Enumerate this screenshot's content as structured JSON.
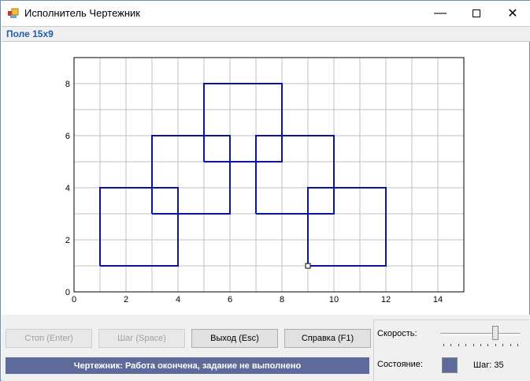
{
  "window": {
    "title": "Исполнитель Чертежник",
    "minimize_icon": "minimize-icon",
    "maximize_icon": "maximize-icon",
    "close_icon": "close-icon"
  },
  "infobar": {
    "label": "Поле 15x9"
  },
  "field": {
    "x_range": [
      0,
      15
    ],
    "y_range": [
      0,
      9
    ],
    "x_ticks": [
      "0",
      "2",
      "4",
      "6",
      "8",
      "10",
      "12",
      "14"
    ],
    "y_ticks": [
      "0",
      "2",
      "4",
      "6",
      "8"
    ],
    "line_color": "#0a14a0",
    "grid_color": "#c0c0c0",
    "segments": [
      [
        [
          1,
          1
        ],
        [
          1,
          4
        ],
        [
          4,
          4
        ],
        [
          4,
          1
        ],
        [
          1,
          1
        ]
      ],
      [
        [
          3,
          3
        ],
        [
          3,
          6
        ],
        [
          6,
          6
        ],
        [
          6,
          3
        ],
        [
          3,
          3
        ]
      ],
      [
        [
          5,
          5
        ],
        [
          5,
          8
        ],
        [
          8,
          8
        ],
        [
          8,
          5
        ],
        [
          5,
          5
        ]
      ],
      [
        [
          7,
          3
        ],
        [
          7,
          6
        ],
        [
          10,
          6
        ],
        [
          10,
          3
        ],
        [
          7,
          3
        ]
      ],
      [
        [
          9,
          1
        ],
        [
          9,
          4
        ],
        [
          12,
          4
        ],
        [
          12,
          1
        ],
        [
          9,
          1
        ]
      ]
    ],
    "pen_position": [
      9,
      1
    ]
  },
  "buttons": {
    "stop": "Стоп (Enter)",
    "step": "Шаг (Space)",
    "exit": "Выход (Esc)",
    "help": "Справка (F1)"
  },
  "status": {
    "text": "Чертежник: Работа окончена, задание не выполнено",
    "color": "#5e6b9a"
  },
  "panel": {
    "speed_label": "Скорость:",
    "speed_value": 7,
    "speed_max": 10,
    "state_label": "Состояние:",
    "step_label": "Шаг: 35"
  }
}
